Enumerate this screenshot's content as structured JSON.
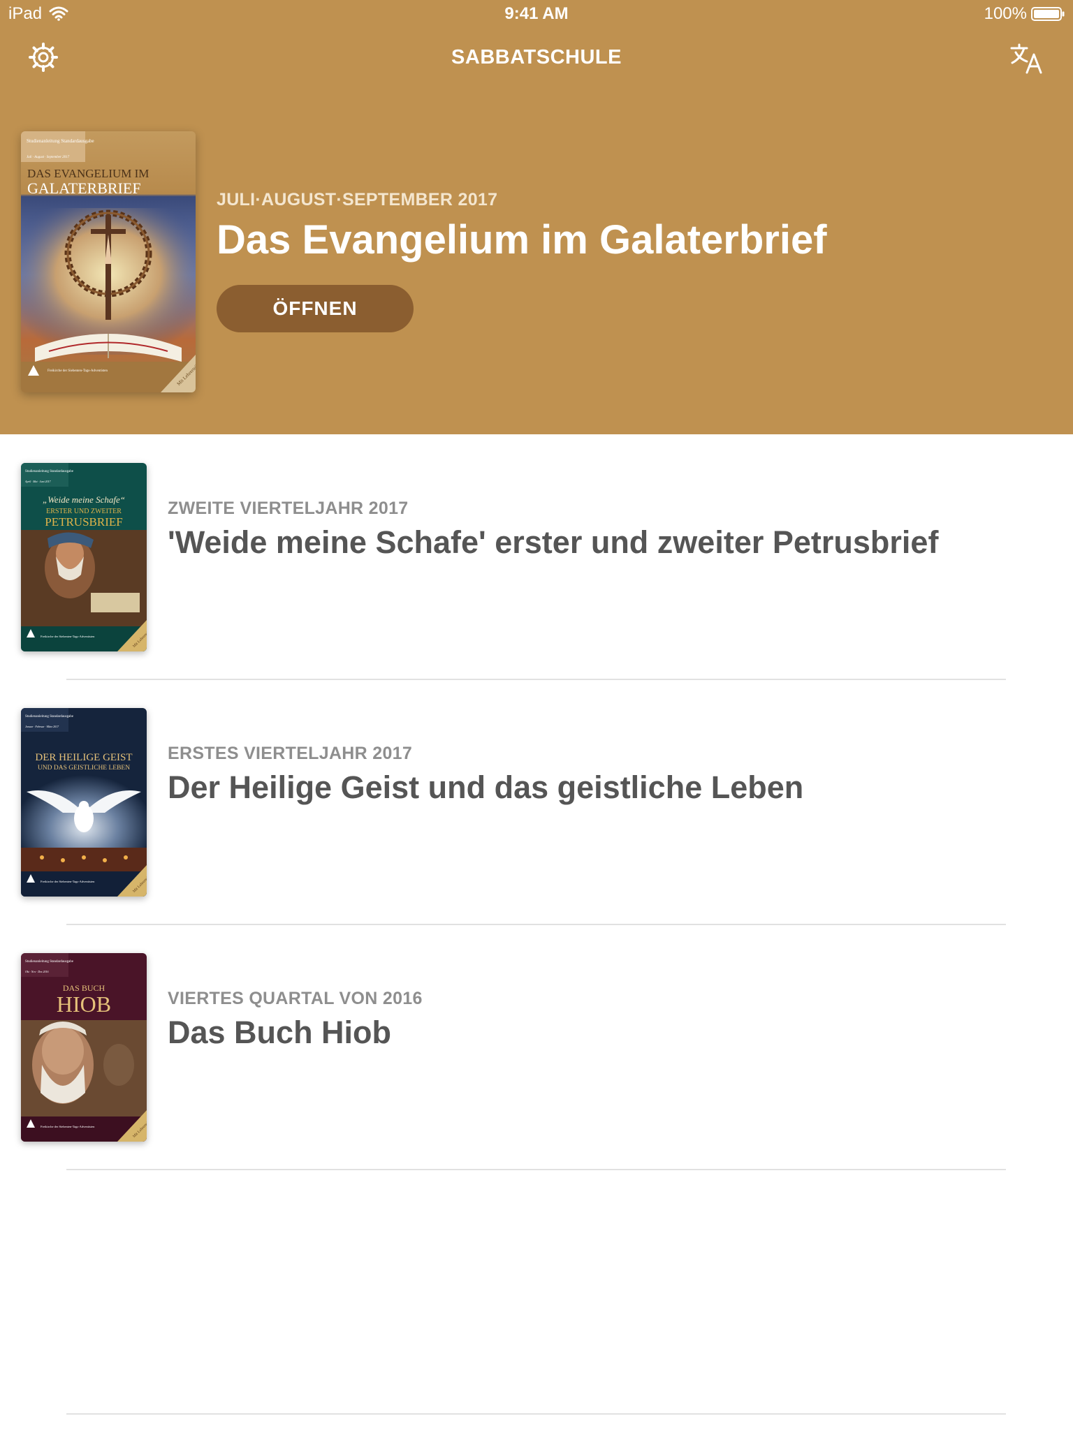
{
  "status_bar": {
    "device": "iPad",
    "time": "9:41 AM",
    "battery": "100%"
  },
  "nav": {
    "title": "SABBATSCHULE"
  },
  "featured": {
    "subtitle": "JULI·AUGUST·SEPTEMBER 2017",
    "title": "Das Evangelium im Galaterbrief",
    "open_label": "ÖFFNEN",
    "cover": {
      "series": "Studienanleitung Standardausgabe",
      "period": "Juli · August · September 2017",
      "line1": "DAS EVANGELIUM IM",
      "line2": "GALATERBRIEF",
      "publisher": "Freikirche der Siebenten-Tags-Adventisten",
      "corner": "Mit Lehrerteil"
    }
  },
  "quarterlies": [
    {
      "subtitle": "ZWEITE VIERTELJAHR 2017",
      "title": "'Weide meine Schafe' erster und zweiter Petrusbrief",
      "cover": {
        "series": "Studienanleitung Standardausgabe",
        "period": "April · Mai · Juni 2017",
        "line1": "„Weide meine Schafe“",
        "line2": "ERSTER UND ZWEITER",
        "line3": "PETRUSBRIEF",
        "publisher": "Freikirche der Siebenten-Tags-Adventisten",
        "corner": "Mit Lehrerteil"
      }
    },
    {
      "subtitle": "ERSTES VIERTELJAHR 2017",
      "title": "Der Heilige Geist und das geistliche Leben",
      "cover": {
        "series": "Studienanleitung Standardausgabe",
        "period": "Januar · Februar · März 2017",
        "line1": "DER HEILIGE GEIST",
        "line2": "UND DAS GEISTLICHE LEBEN",
        "publisher": "Freikirche der Siebenten-Tags-Adventisten",
        "corner": "Mit Lehrerteil"
      }
    },
    {
      "subtitle": "VIERTES QUARTAL VON 2016",
      "title": "Das Buch Hiob",
      "cover": {
        "series": "Studienanleitung Standardausgabe",
        "period": "Okt · Nov · Dez 2016",
        "line1": "DAS BUCH",
        "line2": "HIOB",
        "publisher": "Freikirche der Siebenten-Tags-Adventisten",
        "corner": "Mit Lehrerteil"
      }
    }
  ],
  "colors": {
    "hero_background": "#bf9150",
    "open_button": "#8b5e30",
    "subtitle_gray": "#8e8e8e",
    "title_gray": "#555555",
    "cover_petrus": "#0e4f49",
    "cover_geist": "#15243c",
    "cover_hiob": "#4a1428"
  },
  "icons": {
    "settings": "gear-icon",
    "language": "translate-icon",
    "wifi": "wifi-icon",
    "battery": "battery-icon"
  }
}
